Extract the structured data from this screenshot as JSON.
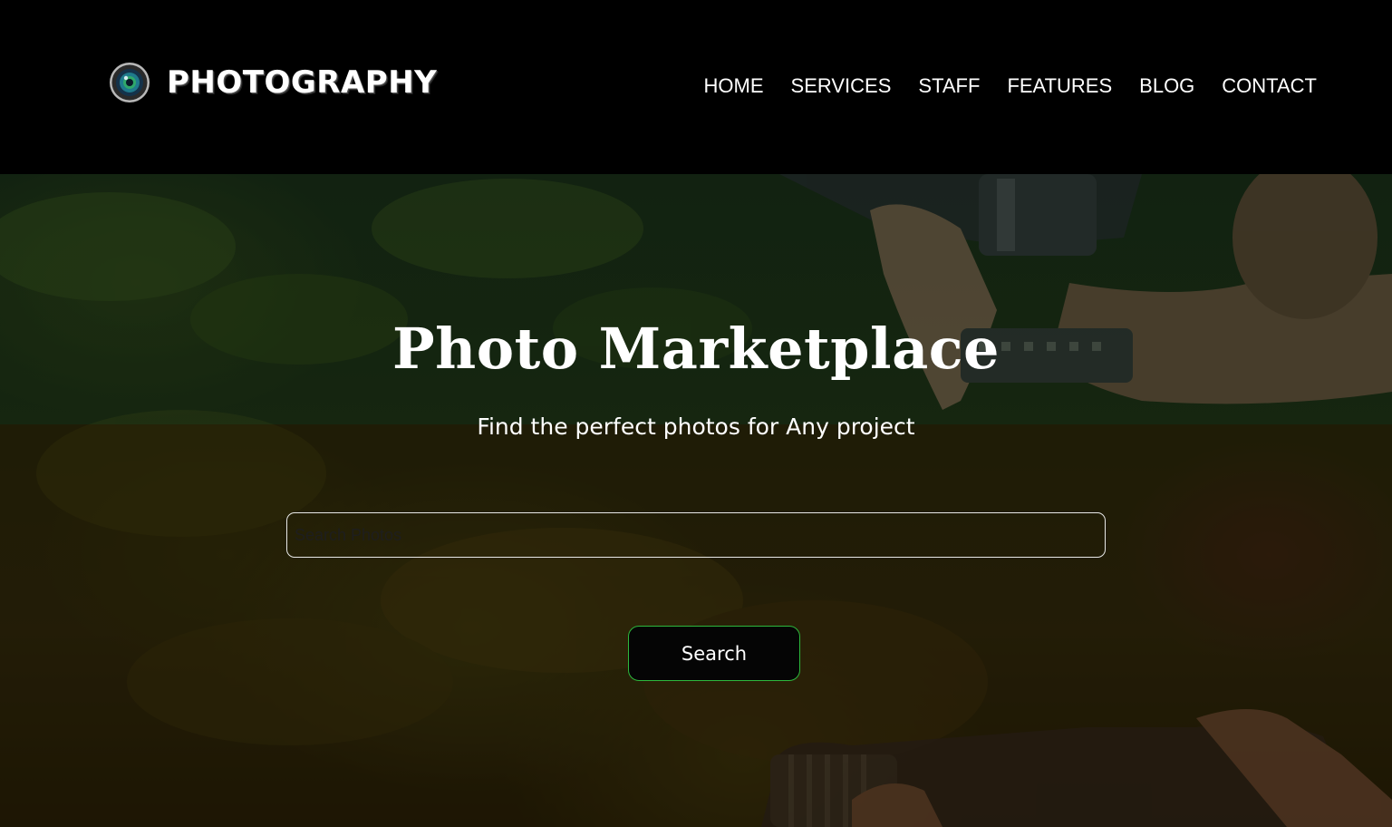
{
  "header": {
    "brand": {
      "name": "PHOTOGRAPHY",
      "icon": "camera-lens-icon"
    },
    "nav": [
      {
        "label": "HOME"
      },
      {
        "label": "SERVICES"
      },
      {
        "label": "STAFF"
      },
      {
        "label": "FEATURES"
      },
      {
        "label": "BLOG"
      },
      {
        "label": "CONTACT"
      }
    ]
  },
  "hero": {
    "title": "Photo Marketplace",
    "subtitle": "Find the perfect photos for Any project",
    "search": {
      "placeholder": "Search Photos",
      "value": ""
    },
    "search_button_label": "Search",
    "background": "photographer-with-camera-image"
  },
  "colors": {
    "header_bg": "#000000",
    "button_border": "#2db83d",
    "text": "#ffffff"
  }
}
